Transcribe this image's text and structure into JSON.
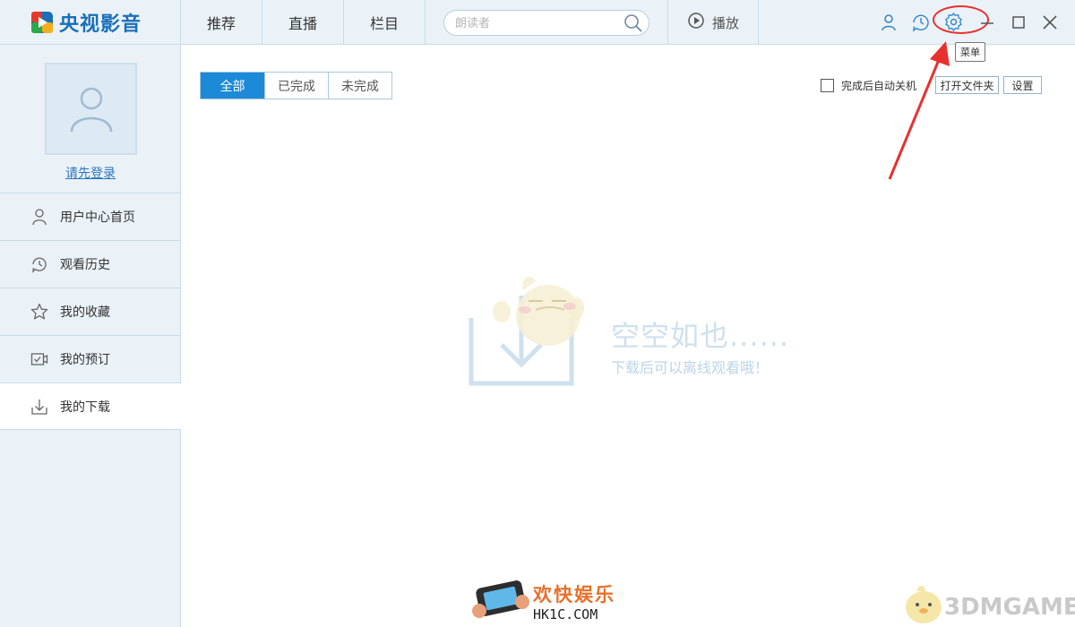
{
  "app": {
    "title": "央视影音",
    "colors": {
      "accent": "#1c8ad6",
      "topbar": "#eaf2f8",
      "highlight": "#e8312f"
    }
  },
  "nav": {
    "tabs": [
      {
        "label": "推荐"
      },
      {
        "label": "直播"
      },
      {
        "label": "栏目"
      }
    ],
    "search_placeholder": "朗读者",
    "play_label": "播放"
  },
  "toolbar": {
    "icons": [
      "user-icon",
      "history-icon",
      "settings-icon",
      "minimize-icon",
      "maximize-icon",
      "close-icon"
    ],
    "tooltip": "菜单"
  },
  "sidebar": {
    "login_text": "请先登录",
    "items": [
      {
        "label": "用户中心首页",
        "icon": "user-icon"
      },
      {
        "label": "观看历史",
        "icon": "history-icon"
      },
      {
        "label": "我的收藏",
        "icon": "star-icon"
      },
      {
        "label": "我的预订",
        "icon": "reservation-icon"
      },
      {
        "label": "我的下载",
        "icon": "download-icon",
        "active": true
      }
    ]
  },
  "main": {
    "filters": [
      {
        "label": "全部",
        "active": true
      },
      {
        "label": "已完成"
      },
      {
        "label": "未完成"
      }
    ],
    "auto_shutdown_label": "完成后自动关机",
    "open_folder_label": "打开文件夹",
    "settings_label": "设置",
    "empty_title": "空空如也......",
    "empty_subtitle": "下载后可以离线观看哦！"
  },
  "watermarks": {
    "left_cn": "欢快娱乐",
    "left_en": "HK1C.COM",
    "right": "3DMGAME"
  }
}
